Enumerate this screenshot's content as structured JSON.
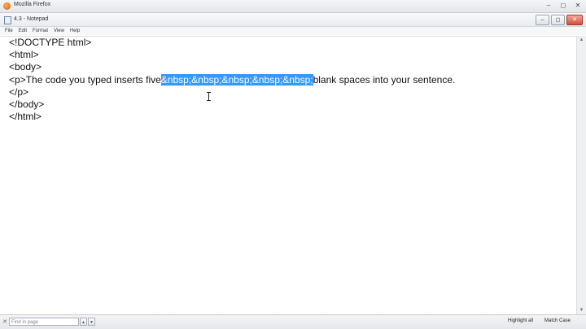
{
  "browser": {
    "title": "Mozilla Firefox",
    "controls": [
      "–",
      "◻",
      "✕"
    ]
  },
  "notepad": {
    "title": "4.3 - Notepad",
    "controls": [
      "–",
      "◻",
      "✕"
    ],
    "menu": [
      "File",
      "Edit",
      "Format",
      "View",
      "Help"
    ]
  },
  "editor": {
    "lines": [
      {
        "text": "<!DOCTYPE html>"
      },
      {
        "text": "<html>"
      },
      {
        "text": "<body>"
      },
      {
        "before": "<p>The code you typed inserts five",
        "selected": "&nbsp;&nbsp;&nbsp;&nbsp;&nbsp;",
        "after": "blank spaces into your sentence."
      },
      {
        "text": "</p>"
      },
      {
        "text": "</body>"
      },
      {
        "text": "</html>"
      }
    ]
  },
  "findbar": {
    "placeholder": "Find in page",
    "highlight_all": "Highlight all",
    "match_case": "Match Case"
  },
  "colors": {
    "selection": "#3399ff"
  }
}
